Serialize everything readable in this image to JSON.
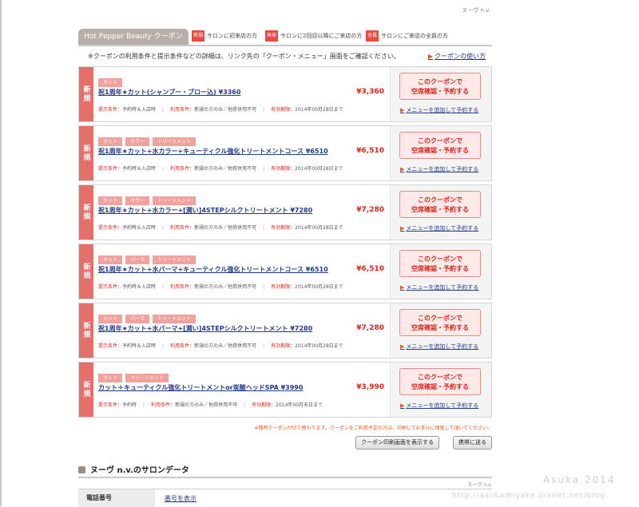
{
  "salon_name_top": "ヌーヴ n.v.",
  "header": {
    "tab": "Hot Pepper Beauty クーポン",
    "legend": [
      {
        "badge": "新規",
        "text": "サロンに初来店の方"
      },
      {
        "badge": "再来",
        "text": "サロンに2回目以降にご来店の方"
      },
      {
        "badge": "全員",
        "text": "サロンにご来店の全員の方"
      }
    ]
  },
  "notice": "※クーポンの利用条件と提示条件などの詳細は、リンク先の「クーポン・メニュー」画面をご確認ください。",
  "howto_link": "クーポンの使い方",
  "coupons": [
    {
      "badge": "新規",
      "tags": [
        "カット"
      ],
      "title": "祝1周年★カット(シャンプー・ブロー込) ¥3360",
      "price": "¥3,360",
      "cond_label": "提示条件：",
      "cond": "予約時＆入店時",
      "use_label": "利用条件：",
      "use": "新規の方のみ／他券併用不可",
      "exp_label": "有効期限：",
      "exp": "2014年00月28日まで",
      "reserve": [
        "このクーポンで",
        "空席確認・予約する"
      ],
      "add_menu": "メニューを追加して予約する"
    },
    {
      "badge": "新規",
      "tags": [
        "カット",
        "カラー",
        "トリートメント"
      ],
      "title": "祝1周年★カット+水カラー+キューティクル強化トリートメントコース ¥6510",
      "price": "¥6,510",
      "cond_label": "提示条件：",
      "cond": "予約時＆入店時",
      "use_label": "利用条件：",
      "use": "新規の方のみ／他券併用不可",
      "exp_label": "有効期限：",
      "exp": "2014年00月28日まで",
      "reserve": [
        "このクーポンで",
        "空席確認・予約する"
      ],
      "add_menu": "メニューを追加して予約する"
    },
    {
      "badge": "新規",
      "tags": [
        "カット",
        "カラー",
        "トリートメント"
      ],
      "title": "祝1周年★カット+水カラー+[潤い]4STEPシルクトリートメント ¥7280",
      "price": "¥7,280",
      "cond_label": "提示条件：",
      "cond": "予約時＆入店時",
      "use_label": "利用条件：",
      "use": "新規の方のみ／他券併用不可",
      "exp_label": "有効期限：",
      "exp": "2014年00月28日まで",
      "reserve": [
        "このクーポンで",
        "空席確認・予約する"
      ],
      "add_menu": "メニューを追加して予約する"
    },
    {
      "badge": "新規",
      "tags": [
        "カット",
        "パーマ",
        "トリートメント"
      ],
      "title": "祝1周年★カット+水パーマ+キューティクル強化トリートメントコース ¥6510",
      "price": "¥6,510",
      "cond_label": "提示条件：",
      "cond": "予約時＆入店時",
      "use_label": "利用条件：",
      "use": "新規の方のみ／他券併用不可",
      "exp_label": "有効期限：",
      "exp": "2014年00月28日まで",
      "reserve": [
        "このクーポンで",
        "空席確認・予約する"
      ],
      "add_menu": "メニューを追加して予約する"
    },
    {
      "badge": "新規",
      "tags": [
        "カット",
        "パーマ",
        "トリートメント"
      ],
      "title": "祝1周年★カット+水パーマ+[潤い]4STEPシルクトリートメント ¥7280",
      "price": "¥7,280",
      "cond_label": "提示条件：",
      "cond": "予約時＆入店時",
      "use_label": "利用条件：",
      "use": "新規の方のみ／他券併用不可",
      "exp_label": "有効期限：",
      "exp": "2014年00月28日まで",
      "reserve": [
        "このクーポンで",
        "空席確認・予約する"
      ],
      "add_menu": "メニューを追加して予約する"
    },
    {
      "badge": "新規",
      "tags": [
        "カット",
        "トリートメント"
      ],
      "title": "カット＋キューティクル強化トリートメントor炭酸ヘッドSPA ¥3990",
      "price": "¥3,990",
      "cond_label": "提示条件：",
      "cond": "予約時",
      "use_label": "利用条件：",
      "use": "新規の方のみ／他券併用不可",
      "exp_label": "有効期限：",
      "exp": "2014年00月末日まで",
      "reserve": [
        "このクーポンで",
        "空席確認・予約する"
      ],
      "add_menu": "メニューを追加して予約する"
    }
  ],
  "warning": "※随時クーポンが切り替わります。クーポンをご利用予定の方は、印刷してお手元に保管して頂いてください。",
  "buttons": {
    "print": "クーポン印刷画面を表示する",
    "mobile": "携帯に送る"
  },
  "salon_data": {
    "title": "ヌーヴ n.v.のサロンデータ",
    "salon_small": "ヌーヴ n.v.",
    "phone_label": "電話番号",
    "phone_link": "番号を表示"
  },
  "watermark": {
    "line1": "Asuka 2014",
    "line2": "http://asukamiyake.pixnet.net/blog"
  }
}
